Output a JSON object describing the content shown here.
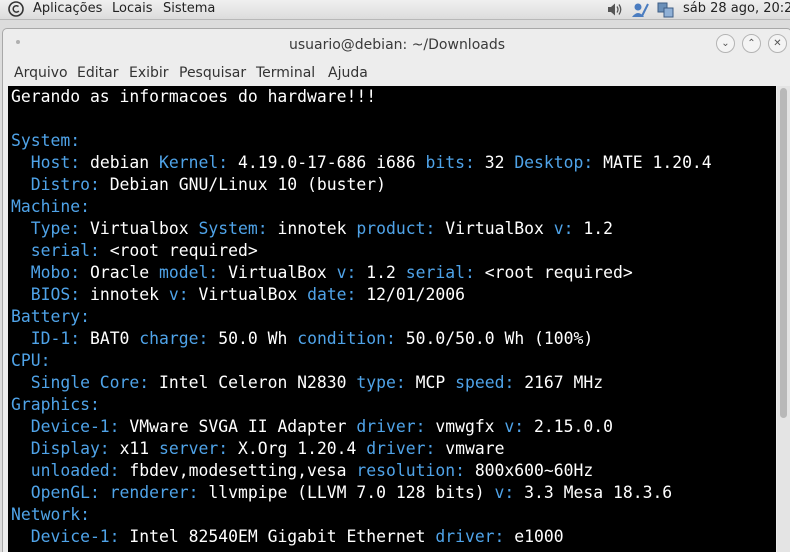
{
  "panel": {
    "menu": [
      "Aplicações",
      "Locais",
      "Sistema"
    ],
    "clock": "sáb 28 ago, 20:2"
  },
  "window": {
    "title": "usuario@debian: ~/Downloads",
    "menu": [
      "Arquivo",
      "Editar",
      "Exibir",
      "Pesquisar",
      "Terminal",
      "Ajuda"
    ]
  },
  "colors": {
    "key": "#4fa3e8",
    "value": "#ffffff",
    "background": "#000000"
  },
  "terminal": {
    "lines": [
      [
        {
          "t": "Gerando as informacoes do hardware!!!",
          "c": "v"
        }
      ],
      [],
      [
        {
          "t": "System:",
          "c": "k"
        }
      ],
      [
        {
          "t": "  Host: ",
          "c": "k"
        },
        {
          "t": "debian ",
          "c": "v"
        },
        {
          "t": "Kernel: ",
          "c": "k"
        },
        {
          "t": "4.19.0-17-686 i686 ",
          "c": "v"
        },
        {
          "t": "bits: ",
          "c": "k"
        },
        {
          "t": "32 ",
          "c": "v"
        },
        {
          "t": "Desktop: ",
          "c": "k"
        },
        {
          "t": "MATE 1.20.4",
          "c": "v"
        }
      ],
      [
        {
          "t": "  Distro: ",
          "c": "k"
        },
        {
          "t": "Debian GNU/Linux 10 (buster)",
          "c": "v"
        }
      ],
      [
        {
          "t": "Machine:",
          "c": "k"
        }
      ],
      [
        {
          "t": "  Type: ",
          "c": "k"
        },
        {
          "t": "Virtualbox ",
          "c": "v"
        },
        {
          "t": "System: ",
          "c": "k"
        },
        {
          "t": "innotek ",
          "c": "v"
        },
        {
          "t": "product: ",
          "c": "k"
        },
        {
          "t": "VirtualBox ",
          "c": "v"
        },
        {
          "t": "v: ",
          "c": "k"
        },
        {
          "t": "1.2",
          "c": "v"
        }
      ],
      [
        {
          "t": "  serial: ",
          "c": "k"
        },
        {
          "t": "<root required>",
          "c": "v"
        }
      ],
      [
        {
          "t": "  Mobo: ",
          "c": "k"
        },
        {
          "t": "Oracle ",
          "c": "v"
        },
        {
          "t": "model: ",
          "c": "k"
        },
        {
          "t": "VirtualBox ",
          "c": "v"
        },
        {
          "t": "v: ",
          "c": "k"
        },
        {
          "t": "1.2 ",
          "c": "v"
        },
        {
          "t": "serial: ",
          "c": "k"
        },
        {
          "t": "<root required>",
          "c": "v"
        }
      ],
      [
        {
          "t": "  BIOS: ",
          "c": "k"
        },
        {
          "t": "innotek ",
          "c": "v"
        },
        {
          "t": "v: ",
          "c": "k"
        },
        {
          "t": "VirtualBox ",
          "c": "v"
        },
        {
          "t": "date: ",
          "c": "k"
        },
        {
          "t": "12/01/2006",
          "c": "v"
        }
      ],
      [
        {
          "t": "Battery:",
          "c": "k"
        }
      ],
      [
        {
          "t": "  ID-1: ",
          "c": "k"
        },
        {
          "t": "BAT0 ",
          "c": "v"
        },
        {
          "t": "charge: ",
          "c": "k"
        },
        {
          "t": "50.0 Wh ",
          "c": "v"
        },
        {
          "t": "condition: ",
          "c": "k"
        },
        {
          "t": "50.0/50.0 Wh (100%)",
          "c": "v"
        }
      ],
      [
        {
          "t": "CPU:",
          "c": "k"
        }
      ],
      [
        {
          "t": "  Single Core: ",
          "c": "k"
        },
        {
          "t": "Intel Celeron N2830 ",
          "c": "v"
        },
        {
          "t": "type: ",
          "c": "k"
        },
        {
          "t": "MCP ",
          "c": "v"
        },
        {
          "t": "speed: ",
          "c": "k"
        },
        {
          "t": "2167 MHz",
          "c": "v"
        }
      ],
      [
        {
          "t": "Graphics:",
          "c": "k"
        }
      ],
      [
        {
          "t": "  Device-1: ",
          "c": "k"
        },
        {
          "t": "VMware SVGA II Adapter ",
          "c": "v"
        },
        {
          "t": "driver: ",
          "c": "k"
        },
        {
          "t": "vmwgfx ",
          "c": "v"
        },
        {
          "t": "v: ",
          "c": "k"
        },
        {
          "t": "2.15.0.0",
          "c": "v"
        }
      ],
      [
        {
          "t": "  Display: ",
          "c": "k"
        },
        {
          "t": "x11 ",
          "c": "v"
        },
        {
          "t": "server: ",
          "c": "k"
        },
        {
          "t": "X.Org 1.20.4 ",
          "c": "v"
        },
        {
          "t": "driver: ",
          "c": "k"
        },
        {
          "t": "vmware",
          "c": "v"
        }
      ],
      [
        {
          "t": "  unloaded: ",
          "c": "k"
        },
        {
          "t": "fbdev,modesetting,vesa ",
          "c": "v"
        },
        {
          "t": "resolution: ",
          "c": "k"
        },
        {
          "t": "800x600~60Hz",
          "c": "v"
        }
      ],
      [
        {
          "t": "  OpenGL: ",
          "c": "k"
        },
        {
          "t": "renderer: ",
          "c": "k"
        },
        {
          "t": "llvmpipe (LLVM 7.0 128 bits) ",
          "c": "v"
        },
        {
          "t": "v: ",
          "c": "k"
        },
        {
          "t": "3.3 Mesa 18.3.6",
          "c": "v"
        }
      ],
      [
        {
          "t": "Network:",
          "c": "k"
        }
      ],
      [
        {
          "t": "  Device-1: ",
          "c": "k"
        },
        {
          "t": "Intel 82540EM Gigabit Ethernet ",
          "c": "v"
        },
        {
          "t": "driver: ",
          "c": "k"
        },
        {
          "t": "e1000",
          "c": "v"
        }
      ]
    ]
  }
}
